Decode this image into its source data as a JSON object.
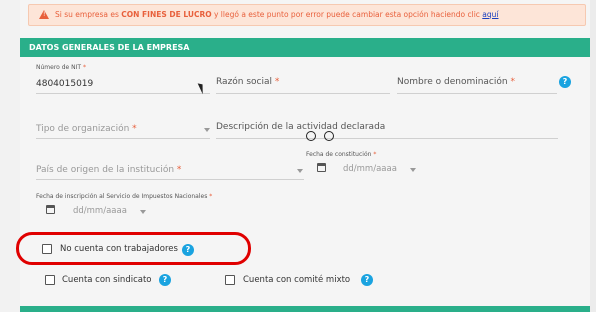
{
  "alert": {
    "prefix": "Si su empresa es ",
    "bold": "CON FINES DE LUCRO",
    "middle": " y llegó a este punto por error puede cambiar esta opción haciendo clic ",
    "link": "aquí"
  },
  "section": {
    "title": "DATOS GENERALES DE LA EMPRESA"
  },
  "fields": {
    "nit_label": "Número de NIT",
    "nit_value": "4804015019",
    "razon_social": "Razón social",
    "nombre": "Nombre o denominación",
    "tipo_org": "Tipo de organización",
    "actividad": "Descripción de la actividad declarada",
    "pais": "País de origen de la institución",
    "fecha_constitucion_label": "Fecha de constitución",
    "fecha_constitucion_ph": "dd/mm/aaaa",
    "fecha_inscripcion_label": "Fecha de inscripción al Servicio de Impuestos Nacionales",
    "fecha_inscripcion_ph": "dd/mm/aaaa",
    "required_mark": "*"
  },
  "checkboxes": {
    "no_trabajadores": "No cuenta con trabajadores",
    "sindicato": "Cuenta con sindicato",
    "comite_mixto": "Cuenta con comité mixto"
  },
  "help_symbol": "?",
  "colors": {
    "accent": "#2aaf8a",
    "warning": "#e8603c",
    "highlight": "#e00000",
    "help": "#1aa3e0"
  }
}
